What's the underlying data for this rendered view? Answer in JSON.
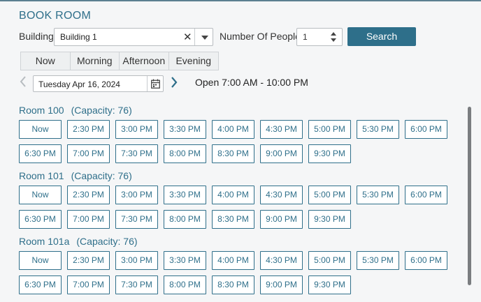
{
  "header": {
    "title": "BOOK ROOM"
  },
  "filters": {
    "building_label": "Building",
    "building_value": "Building 1",
    "people_label": "Number Of People",
    "people_value": "1",
    "search_label": "Search"
  },
  "tabs": [
    {
      "label": "Now"
    },
    {
      "label": "Morning"
    },
    {
      "label": "Afternoon"
    },
    {
      "label": "Evening"
    }
  ],
  "date": {
    "value": "Tuesday Apr 16, 2024",
    "hours": "Open 7:00 AM - 10:00 PM"
  },
  "rooms": [
    {
      "name": "Room 100",
      "capacity": "(Capacity: 76)",
      "slots": [
        "Now",
        "2:30 PM",
        "3:00 PM",
        "3:30 PM",
        "4:00 PM",
        "4:30 PM",
        "5:00 PM",
        "5:30 PM",
        "6:00 PM",
        "6:30 PM",
        "7:00 PM",
        "7:30 PM",
        "8:00 PM",
        "8:30 PM",
        "9:00 PM",
        "9:30 PM"
      ]
    },
    {
      "name": "Room 101",
      "capacity": "(Capacity: 76)",
      "slots": [
        "Now",
        "2:30 PM",
        "3:00 PM",
        "3:30 PM",
        "4:00 PM",
        "4:30 PM",
        "5:00 PM",
        "5:30 PM",
        "6:00 PM",
        "6:30 PM",
        "7:00 PM",
        "7:30 PM",
        "8:00 PM",
        "8:30 PM",
        "9:00 PM",
        "9:30 PM"
      ]
    },
    {
      "name": "Room 101a",
      "capacity": "(Capacity: 76)",
      "slots": [
        "Now",
        "2:30 PM",
        "3:00 PM",
        "3:30 PM",
        "4:00 PM",
        "4:30 PM",
        "5:00 PM",
        "5:30 PM",
        "6:00 PM",
        "6:30 PM",
        "7:00 PM",
        "7:30 PM",
        "8:00 PM",
        "8:30 PM",
        "9:00 PM",
        "9:30 PM"
      ]
    }
  ],
  "colors": {
    "accent": "#2e6f8a",
    "background": "#f5f6f7"
  }
}
